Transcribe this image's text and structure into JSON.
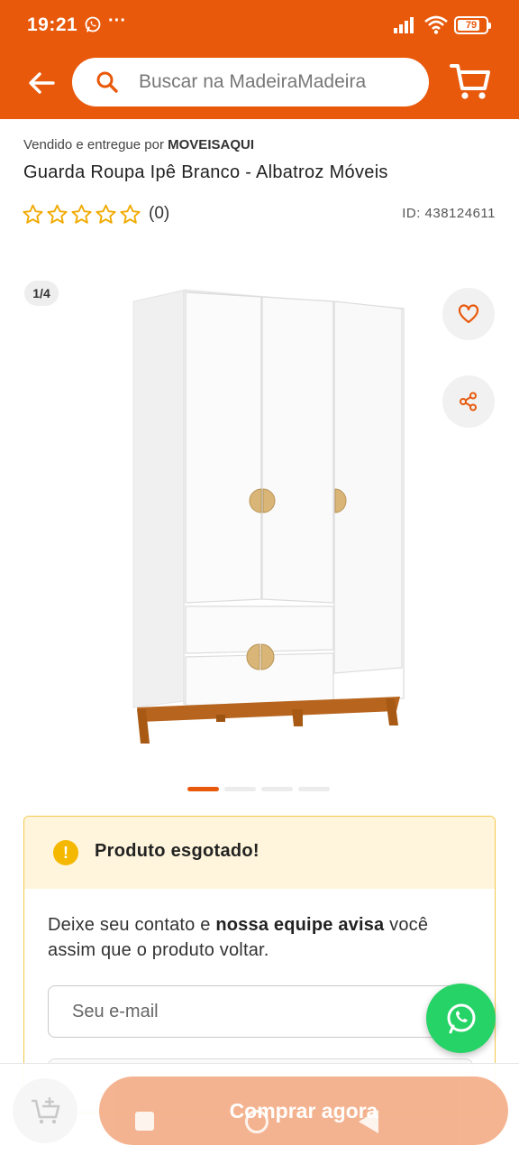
{
  "status_bar": {
    "time": "19:21",
    "more": "···",
    "battery": "79",
    "battery_fraction": 0.79
  },
  "header": {
    "search_placeholder": "Buscar na MadeiraMadeira",
    "brand_color": "#E8590C",
    "icons": [
      "back-arrow-icon",
      "search-icon",
      "cart-icon"
    ]
  },
  "product": {
    "seller_prefix": "Vendido e entregue por",
    "seller_name": "MOVEISAQUI",
    "title": "Guarda Roupa Ipê Branco - Albatroz Móveis",
    "rating_stars": 0,
    "rating_count": "(0)",
    "id": "ID: 438124611",
    "image_counter": "1/4",
    "image_index": 1,
    "image_total": 4
  },
  "out_of_stock": {
    "title": "Produto esgotado!",
    "message_part1": "Deixe seu contato e ",
    "message_bold": "nossa equipe avisa",
    "message_part2": " você assim que o produto voltar.",
    "email_placeholder": "Seu e-mail"
  },
  "bottom_bar": {
    "buy_label": "Comprar agora",
    "accent": "#E8590C"
  },
  "fab": {
    "icon": "whatsapp-icon",
    "color": "#25D366"
  }
}
